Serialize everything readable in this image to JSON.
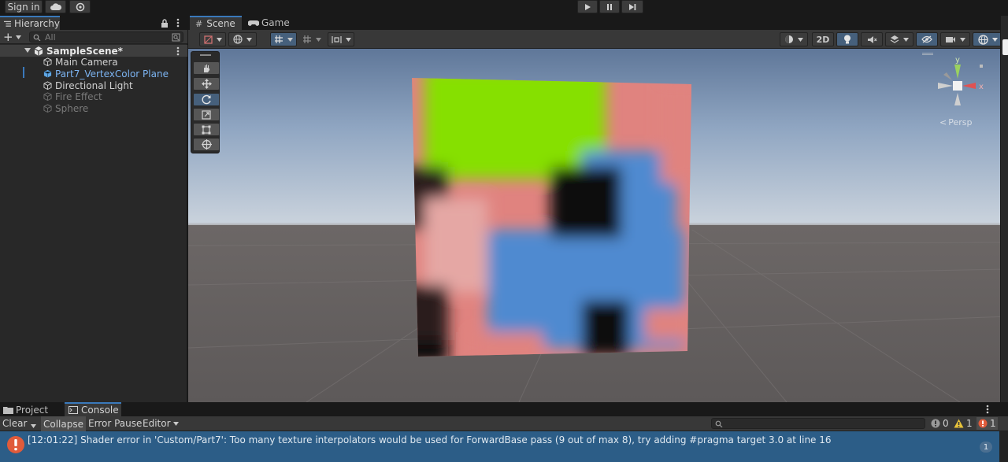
{
  "topbar": {
    "sign_in": "Sign in",
    "cloud_icon": "cloud-icon",
    "collab_icon": "collab-icon",
    "play_icon": "play-icon",
    "pause_icon": "pause-icon",
    "step_icon": "step-icon"
  },
  "hierarchy": {
    "tab_label": "Hierarchy",
    "search_placeholder": "All",
    "add_label": "+",
    "scene_name": "SampleScene*",
    "items": [
      {
        "label": "Main Camera",
        "state": "normal"
      },
      {
        "label": "Part7_VertexColor Plane",
        "state": "selected"
      },
      {
        "label": "Directional Light",
        "state": "normal"
      },
      {
        "label": "Fire Effect",
        "state": "disabled"
      },
      {
        "label": "Sphere",
        "state": "disabled"
      }
    ]
  },
  "scene_view": {
    "tabs": [
      {
        "label": "Scene",
        "active": true
      },
      {
        "label": "Game",
        "active": false
      }
    ],
    "toggle_2d": "2D",
    "gizmo_persp_label": "Persp",
    "gizmo_axes": {
      "y": "y",
      "x": "x"
    },
    "tools": [
      "view-tool",
      "move-tool",
      "rotate-tool",
      "scale-tool",
      "rect-tool",
      "transform-tool"
    ],
    "active_tool": "rotate-tool"
  },
  "console": {
    "tabs": [
      {
        "label": "Project",
        "active": false
      },
      {
        "label": "Console",
        "active": true
      }
    ],
    "buttons": {
      "clear": "Clear",
      "collapse": "Collapse",
      "error_pause": "Error Pause",
      "editor": "Editor"
    },
    "counts": {
      "info": "0",
      "warnings": "1",
      "errors": "1"
    },
    "messages": [
      {
        "text": "[12:01:22] Shader error in 'Custom/Part7': Too many texture interpolators would be used for ForwardBase pass (9 out of max 8), try adding #pragma target 3.0 at line 16",
        "count": "1"
      }
    ]
  },
  "colors": {
    "accent": "#3a79bb",
    "selected_text": "#7cb4f2",
    "error": "#e05b3b",
    "warning": "#e8c33a",
    "message_row": "#2c5d87"
  }
}
